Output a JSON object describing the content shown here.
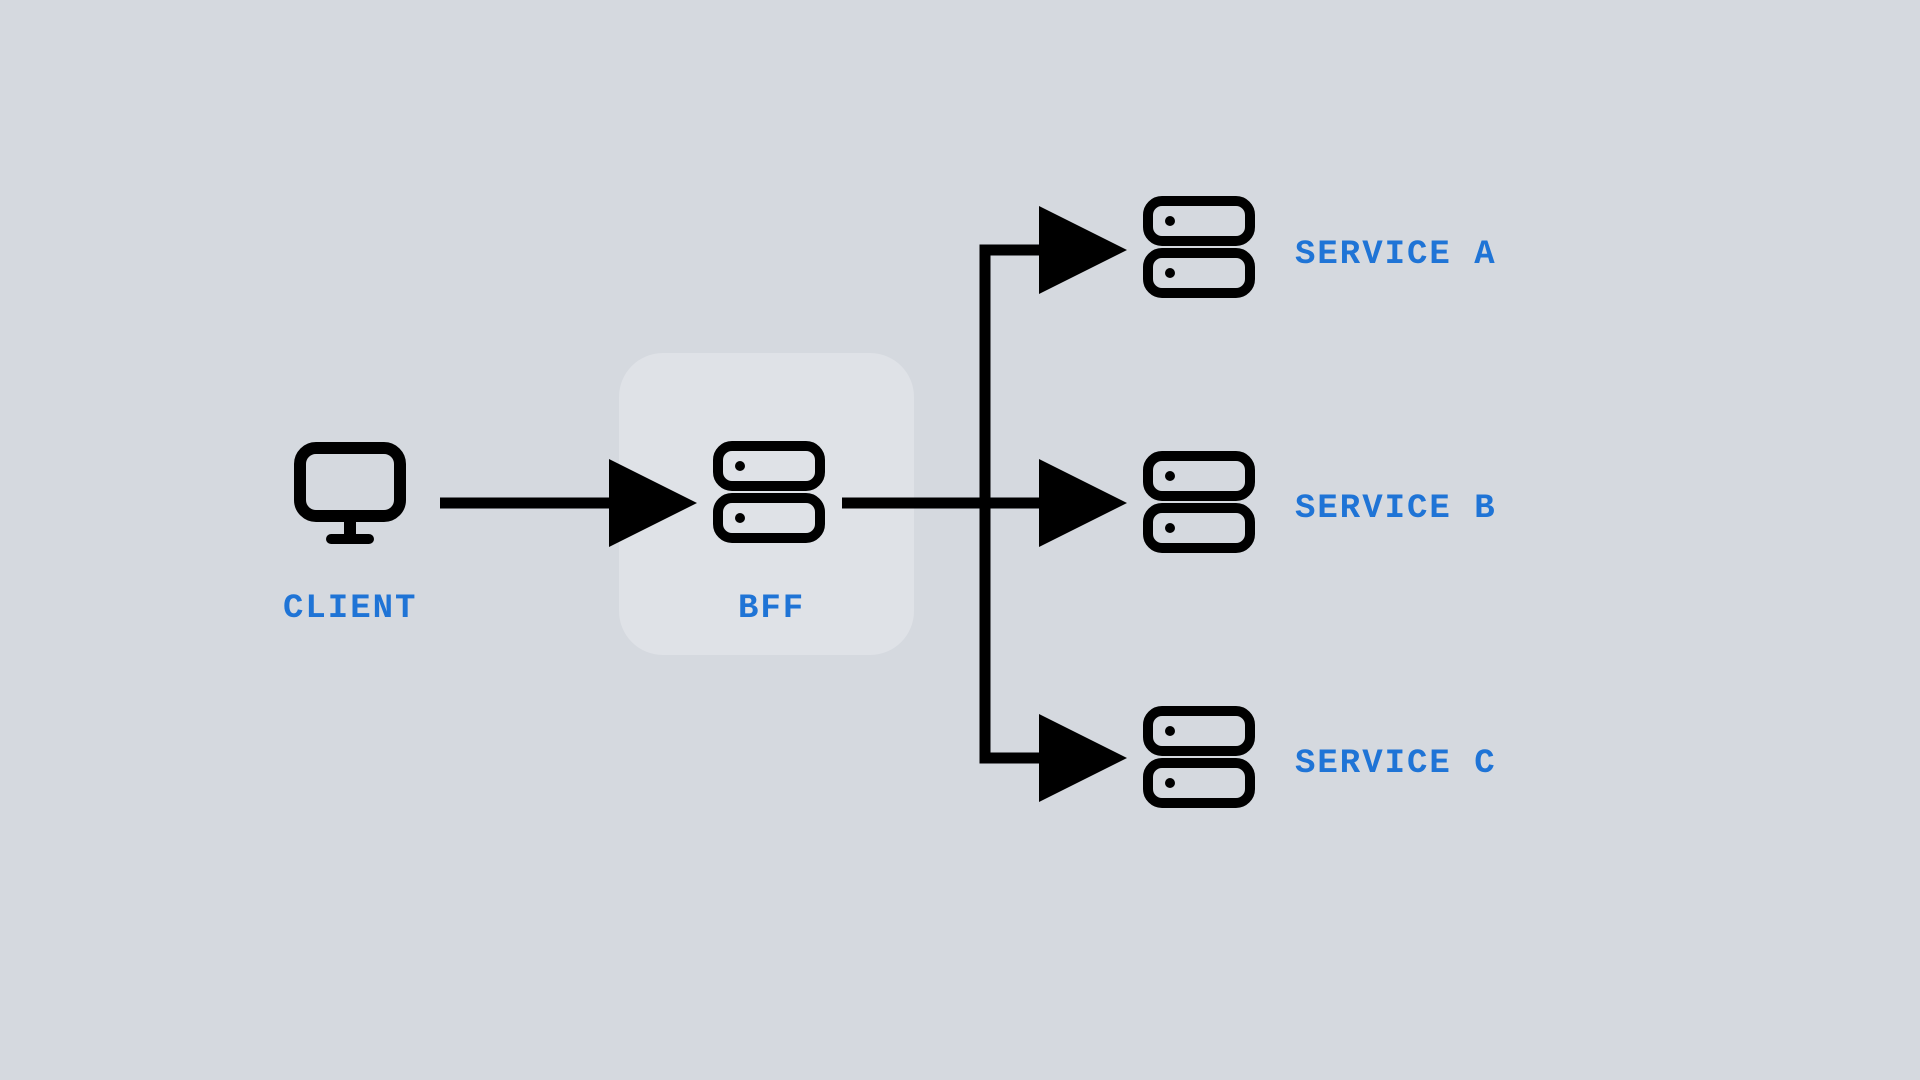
{
  "colors": {
    "bg": "#d5d9df",
    "bffBg": "#dfe2e7",
    "label": "#1f74d6",
    "stroke": "#000000"
  },
  "nodes": {
    "client": {
      "label": "CLIENT"
    },
    "bff": {
      "label": "BFF"
    },
    "services": [
      {
        "id": "a",
        "label": "SERVICE A"
      },
      {
        "id": "b",
        "label": "SERVICE B"
      },
      {
        "id": "c",
        "label": "SERVICE C"
      }
    ]
  },
  "edges": [
    {
      "from": "client",
      "to": "bff"
    },
    {
      "from": "bff",
      "to": "service-a"
    },
    {
      "from": "bff",
      "to": "service-b"
    },
    {
      "from": "bff",
      "to": "service-c"
    }
  ]
}
